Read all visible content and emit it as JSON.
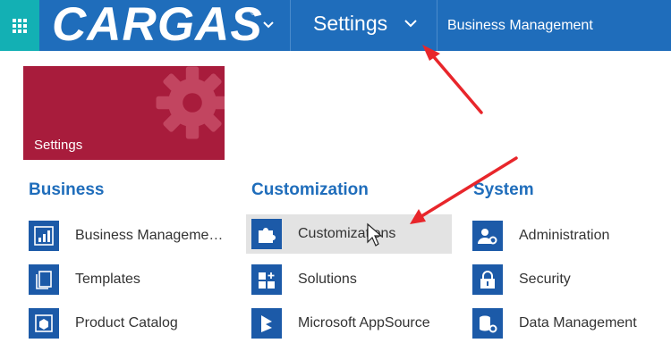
{
  "header": {
    "logo_text": "CARGAS",
    "logo_registered": "®",
    "area_label": "Settings",
    "breadcrumb_label": "Business Management",
    "bar_color": "#1f6dbb",
    "app_grid_color": "#13b0b4"
  },
  "tile": {
    "label": "Settings",
    "color": "#a81c3c"
  },
  "groups": {
    "business": {
      "title": "Business",
      "items": [
        {
          "label": "Business Manageme…",
          "icon": "business-management-icon"
        },
        {
          "label": "Templates",
          "icon": "templates-icon"
        },
        {
          "label": "Product Catalog",
          "icon": "product-catalog-icon"
        }
      ]
    },
    "customization": {
      "title": "Customization",
      "items": [
        {
          "label": "Customizations",
          "icon": "puzzle-icon"
        },
        {
          "label": "Solutions",
          "icon": "solutions-icon"
        },
        {
          "label": "Microsoft AppSource",
          "icon": "appsource-icon"
        }
      ]
    },
    "system": {
      "title": "System",
      "items": [
        {
          "label": "Administration",
          "icon": "administration-icon"
        },
        {
          "label": "Security",
          "icon": "lock-icon"
        },
        {
          "label": "Data Management",
          "icon": "data-management-icon"
        }
      ]
    }
  },
  "annotations": {
    "arrow_color": "#e8262b"
  }
}
